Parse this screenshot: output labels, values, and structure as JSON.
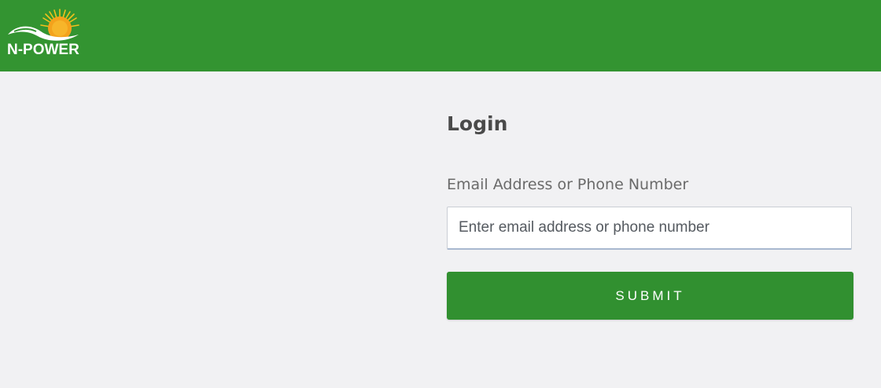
{
  "header": {
    "logo_text": "N-POWER",
    "logo_icon": "sun-swoosh-logo",
    "background_color": "#339431"
  },
  "login": {
    "title": "Login",
    "field_label": "Email Address or Phone Number",
    "input_placeholder": "Enter email address or phone number",
    "input_value": "",
    "submit_label": "SUBMIT",
    "button_color": "#319030"
  },
  "page": {
    "background_color": "#f1f1f3"
  }
}
